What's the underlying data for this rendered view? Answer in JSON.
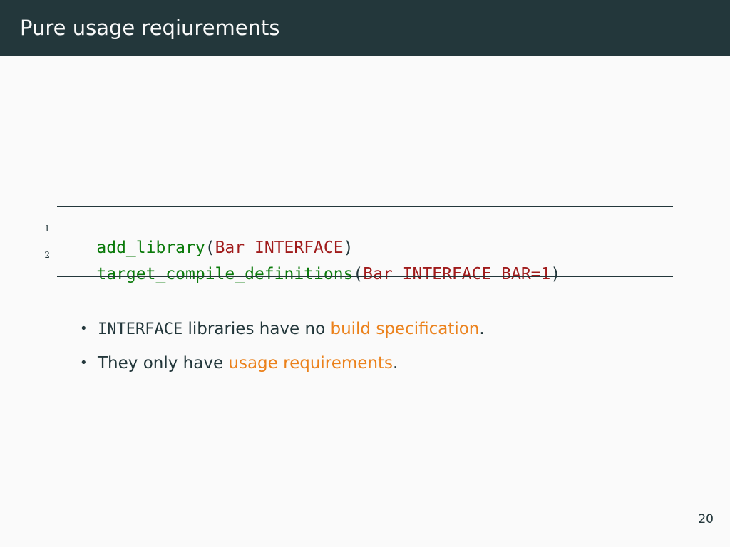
{
  "slide": {
    "title": "Pure usage reqiurements",
    "page_number": "20"
  },
  "code": {
    "lines": [
      {
        "number": "1",
        "function": "add_library",
        "open": "(",
        "args": "Bar INTERFACE",
        "close": ")"
      },
      {
        "number": "2",
        "function": "target_compile_definitions",
        "open": "(",
        "args": "Bar INTERFACE BAR=1",
        "close": ")"
      }
    ]
  },
  "bullets": [
    {
      "mono": "INTERFACE",
      "text_before": " libraries have no ",
      "highlight": "build specification",
      "text_after": "."
    },
    {
      "text_before": "They only have ",
      "highlight": "usage requirements",
      "text_after": "."
    }
  ],
  "colors": {
    "header_background": "#23373b",
    "header_text": "#fafafa",
    "slide_background": "#fafafa",
    "accent": "#eb811b",
    "code_function": "#0a7a0a",
    "code_argument": "#a01b1b"
  }
}
